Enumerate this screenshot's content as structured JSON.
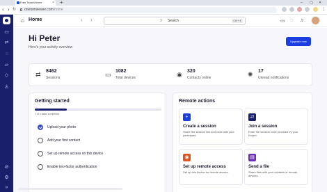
{
  "browser": {
    "tab_title": "Free TeamViewer",
    "new_tab": "+",
    "tab_close": "×",
    "url_domain": "onetomviewer.com",
    "url_path": "/home",
    "win_min": "–",
    "win_max": "▢",
    "win_close": "✕"
  },
  "sidebar": {
    "items": [
      {
        "icon": "computer-icon",
        "glyph": "▭"
      },
      {
        "icon": "swap-icon",
        "glyph": "⇄"
      },
      {
        "icon": "chat-icon",
        "glyph": "◌"
      },
      {
        "icon": "folder-icon",
        "glyph": "▱"
      },
      {
        "icon": "tag-icon",
        "glyph": "◇"
      },
      {
        "icon": "shield-icon",
        "glyph": "◬"
      },
      {
        "icon": "link-icon",
        "glyph": "⊘"
      },
      {
        "icon": "settings-icon",
        "glyph": "⚙"
      },
      {
        "icon": "collapse-icon",
        "glyph": "»"
      }
    ]
  },
  "header": {
    "title": "Home",
    "search_label": "Search",
    "search_shortcut": "Ctrl + K"
  },
  "main": {
    "greeting": "Hi Peter",
    "subtitle": "Here's your activity overview",
    "upgrade_label": "Upgrade now"
  },
  "stats": [
    {
      "icon": "sessions-icon",
      "glyph": "⇄",
      "value": "8462",
      "label": "Sessions"
    },
    {
      "icon": "devices-icon",
      "glyph": "▭",
      "value": "1082",
      "label": "Total devices"
    },
    {
      "icon": "contacts-icon",
      "glyph": "◉",
      "value": "320",
      "label": "Contacts online"
    },
    {
      "icon": "notifications-icon",
      "glyph": "✺",
      "value": "17",
      "label": "Unread notifications"
    }
  ],
  "getting_started": {
    "title": "Getting started",
    "progress_fraction": 0.25,
    "progress_text": "1 of 4 tasks completed",
    "tasks": [
      {
        "label": "Upload your photo",
        "done": true
      },
      {
        "label": "Add your first contact",
        "done": false
      },
      {
        "label": "Set up remote access on this device",
        "done": false
      },
      {
        "label": "Enable two-factor authentication",
        "done": false
      }
    ]
  },
  "remote_actions": {
    "title": "Remote actions",
    "actions": [
      {
        "title": "Create a session",
        "desc": "Share the session link and code with your participant.",
        "icon": "create-session-icon",
        "glyph": "+",
        "color": "#1a3ee0"
      },
      {
        "title": "Join a session",
        "desc": "Enter the session code provided by your Expert.",
        "icon": "join-session-icon",
        "glyph": "⇄",
        "color": "#1a1f6b"
      },
      {
        "title": "Set up remote access",
        "desc": "Set up this device for remote access.",
        "icon": "remote-access-icon",
        "glyph": "◉",
        "color": "#e0531f"
      },
      {
        "title": "Send a file",
        "desc": "Share files with your contacts or remote devices.",
        "icon": "send-file-icon",
        "glyph": "▤",
        "color": "#6b2fb8"
      }
    ]
  },
  "colors": {
    "sidebar": "#1a1f6b",
    "accent": "#1a3ee0"
  }
}
